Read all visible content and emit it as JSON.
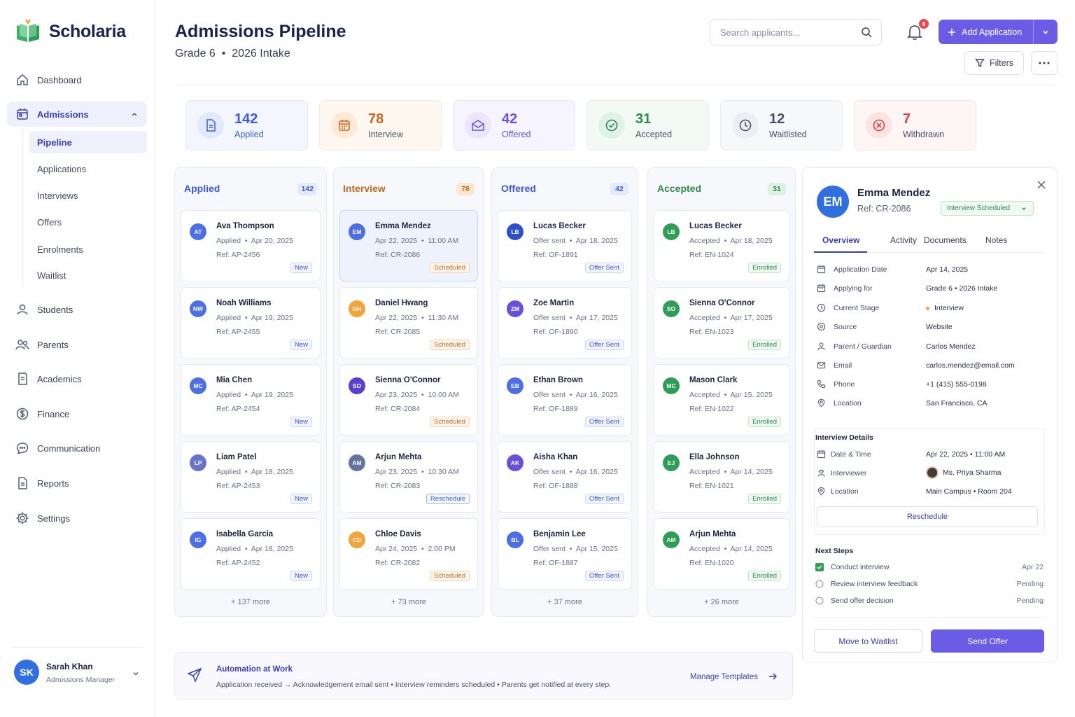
{
  "app": {
    "name": "Scholaria"
  },
  "nav": [
    {
      "label": "Dashboard",
      "icon": "home-icon"
    },
    {
      "label": "Admissions",
      "icon": "calendar-icon"
    },
    {
      "label": "Students",
      "icon": "user-icon"
    },
    {
      "label": "Parents",
      "icon": "users-icon"
    },
    {
      "label": "Academics",
      "icon": "book-icon"
    },
    {
      "label": "Finance",
      "icon": "dollar-icon"
    },
    {
      "label": "Communication",
      "icon": "chat-icon"
    },
    {
      "label": "Reports",
      "icon": "file-icon"
    },
    {
      "label": "Settings",
      "icon": "gear-icon"
    }
  ],
  "subnav": [
    "Pipeline",
    "Applications",
    "Interviews",
    "Offers",
    "Enrolments",
    "Waitlist"
  ],
  "user": {
    "initials": "SK",
    "name": "Sarah Khan",
    "role": "Admissions Manager"
  },
  "header": {
    "title": "Admissions Pipeline",
    "grade": "Grade 6",
    "intake": "2026 Intake",
    "search_placeholder": "Search applicants...",
    "notif_count": "8",
    "add_label": "Add Application",
    "filters_label": "Filters"
  },
  "stats": [
    {
      "num": "142",
      "label": "Applied",
      "color": "#3b5bdb"
    },
    {
      "num": "78",
      "label": "Interview",
      "color": "#c8661f"
    },
    {
      "num": "42",
      "label": "Offered",
      "color": "#6b4fd8"
    },
    {
      "num": "31",
      "label": "Accepted",
      "color": "#2c8a4a"
    },
    {
      "num": "12",
      "label": "Waitlisted",
      "color": "#4a4f68"
    },
    {
      "num": "7",
      "label": "Withdrawn",
      "color": "#d9434a"
    }
  ],
  "columns": [
    {
      "title": "Applied",
      "count": "142",
      "color": "#3b5bdb",
      "more": "+ 137 more",
      "cards": [
        {
          "initials": "AT",
          "name": "Ava Thompson",
          "line1": "Applied",
          "date": "Apr 20, 2025",
          "ref": "Ref: AP-2456",
          "tag": "New",
          "avc": "#4d6fe6"
        },
        {
          "initials": "NW",
          "name": "Noah Williams",
          "line1": "Applied",
          "date": "Apr 19, 2025",
          "ref": "Ref: AP-2455",
          "tag": "New",
          "avc": "#4d6fe6"
        },
        {
          "initials": "MC",
          "name": "Mia Chen",
          "line1": "Applied",
          "date": "Apr 19, 2025",
          "ref": "Ref: AP-2454",
          "tag": "New",
          "avc": "#4d6fe6"
        },
        {
          "initials": "LP",
          "name": "Liam Patel",
          "line1": "Applied",
          "date": "Apr 18, 2025",
          "ref": "Ref: AP-2453",
          "tag": "New",
          "avc": "#6674c9"
        },
        {
          "initials": "IG",
          "name": "Isabella Garcia",
          "line1": "Applied",
          "date": "Apr 18, 2025",
          "ref": "Ref: AP-2452",
          "tag": "New",
          "avc": "#4d6fe6"
        }
      ]
    },
    {
      "title": "Interview",
      "count": "78",
      "color": "#c8661f",
      "more": "+ 73 more",
      "cards": [
        {
          "initials": "EM",
          "name": "Emma Mendez",
          "line1": "Apr 22, 2025",
          "date": "11:00 AM",
          "ref": "Ref: CR-2086",
          "tag": "Scheduled",
          "avc": "#4d6fe6"
        },
        {
          "initials": "DH",
          "name": "Daniel Hwang",
          "line1": "Apr 22, 2025",
          "date": "11:30 AM",
          "ref": "Ref: CR-2085",
          "tag": "Scheduled",
          "avc": "#f0a43a"
        },
        {
          "initials": "SO",
          "name": "Sienna O'Connor",
          "line1": "Apr 23, 2025",
          "date": "10:00 AM",
          "ref": "Ref: CR-2084",
          "tag": "Scheduled",
          "avc": "#5b3fd0"
        },
        {
          "initials": "AM",
          "name": "Arjun Mehta",
          "line1": "Apr 23, 2025",
          "date": "10:30 AM",
          "ref": "Ref: CR-2083",
          "tag": "Reschedule",
          "avc": "#6674a0"
        },
        {
          "initials": "CD",
          "name": "Chloe Davis",
          "line1": "Apr 24, 2025",
          "date": "2:00 PM",
          "ref": "Ref: CR-2082",
          "tag": "Scheduled",
          "avc": "#f0a43a"
        }
      ]
    },
    {
      "title": "Offered",
      "count": "42",
      "color": "#3b5bdb",
      "more": "+ 37 more",
      "cards": [
        {
          "initials": "LB",
          "name": "Lucas Becker",
          "line1": "Offer sent",
          "date": "Apr 18, 2025",
          "ref": "Ref: OF-1891",
          "tag": "Offer Sent",
          "avc": "#2d4fc8"
        },
        {
          "initials": "ZM",
          "name": "Zoe Martin",
          "line1": "Offer sent",
          "date": "Apr 17, 2025",
          "ref": "Ref: OF-1890",
          "tag": "Offer Sent",
          "avc": "#6b4fd8"
        },
        {
          "initials": "EB",
          "name": "Ethan Brown",
          "line1": "Offer sent",
          "date": "Apr 16, 2025",
          "ref": "Ref: OF-1889",
          "tag": "Offer Sent",
          "avc": "#4d6fe6"
        },
        {
          "initials": "AK",
          "name": "Aisha Khan",
          "line1": "Offer sent",
          "date": "Apr 16, 2025",
          "ref": "Ref: OF-1888",
          "tag": "Offer Sent",
          "avc": "#6b4fd8"
        },
        {
          "initials": "BL",
          "name": "Benjamin Lee",
          "line1": "Offer sent",
          "date": "Apr 15, 2025",
          "ref": "Ref: OF-1887",
          "tag": "Offer Sent",
          "avc": "#4d6fe6"
        }
      ]
    },
    {
      "title": "Accepted",
      "count": "31",
      "color": "#2c8a4a",
      "more": "+ 26 more",
      "cards": [
        {
          "initials": "LB",
          "name": "Lucas Becker",
          "line1": "Accepted",
          "date": "Apr 18, 2025",
          "ref": "Ref: EN-1024",
          "tag": "Enrolled",
          "avc": "#2e9d57"
        },
        {
          "initials": "SO",
          "name": "Sienna O'Connor",
          "line1": "Accepted",
          "date": "Apr 17, 2025",
          "ref": "Ref: EN-1023",
          "tag": "Enrolled",
          "avc": "#2e9d57"
        },
        {
          "initials": "MC",
          "name": "Mason Clark",
          "line1": "Accepted",
          "date": "Apr 15, 2025",
          "ref": "Ref: EN-1022",
          "tag": "Enrolled",
          "avc": "#2e9d57"
        },
        {
          "initials": "EJ",
          "name": "Ella Johnson",
          "line1": "Accepted",
          "date": "Apr 14, 2025",
          "ref": "Ref: EN-1021",
          "tag": "Enrolled",
          "avc": "#2e9d57"
        },
        {
          "initials": "AM",
          "name": "Arjun Mehta",
          "line1": "Accepted",
          "date": "Apr 14, 2025",
          "ref": "Ref: EN-1020",
          "tag": "Enrolled",
          "avc": "#2e9d57"
        }
      ]
    }
  ],
  "detail": {
    "initials": "EM",
    "name": "Emma Mendez",
    "ref": "Ref: CR-2086",
    "status": "Interview Scheduled",
    "tabs": [
      "Overview",
      "Activity",
      "Documents",
      "Notes"
    ],
    "fields": [
      {
        "k": "Application Date",
        "v": "Apr 14, 2025"
      },
      {
        "k": "Applying for",
        "v": "Grade 6 • 2026 Intake"
      },
      {
        "k": "Current Stage",
        "v": "Interview"
      },
      {
        "k": "Source",
        "v": "Website"
      },
      {
        "k": "Parent / Guardian",
        "v": "Carlos Mendez"
      },
      {
        "k": "Email",
        "v": "carlos.mendez@email.com"
      },
      {
        "k": "Phone",
        "v": "+1 (415) 555-0198"
      },
      {
        "k": "Location",
        "v": "San Francisco, CA"
      }
    ],
    "interview": {
      "title": "Interview Details",
      "rows": [
        {
          "k": "Date & Time",
          "v": "Apr 22, 2025 • 11:00 AM"
        },
        {
          "k": "Interviewer",
          "v": "Ms. Priya Sharma"
        },
        {
          "k": "Location",
          "v": "Main Campus • Room 204"
        }
      ],
      "reschedule": "Reschedule"
    },
    "next": {
      "title": "Next Steps",
      "steps": [
        {
          "t": "Conduct interview",
          "s": "Apr 22",
          "done": true
        },
        {
          "t": "Review interview feedback",
          "s": "Pending",
          "done": false
        },
        {
          "t": "Send offer decision",
          "s": "Pending",
          "done": false
        }
      ]
    },
    "btn_waitlist": "Move to Waitlist",
    "btn_offer": "Send Offer"
  },
  "automation": {
    "title": "Automation at Work",
    "desc": "Application received → Acknowledgement email sent • Interview reminders scheduled • Parents get notified at every step.",
    "link": "Manage Templates"
  }
}
